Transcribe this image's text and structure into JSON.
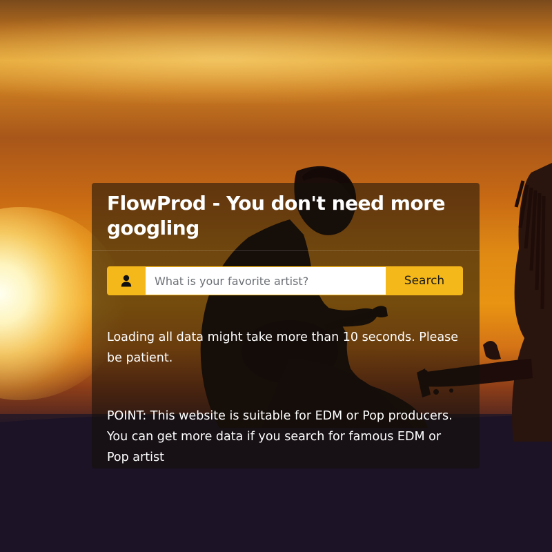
{
  "header": {
    "title": "FlowProd - You don't need more googling"
  },
  "search": {
    "icon": "user-icon",
    "placeholder": "What is your favorite artist?",
    "value": "",
    "button_label": "Search"
  },
  "info": {
    "loading_note": "Loading all data might take more than 10 seconds. Please be patient.",
    "point_note": "POINT: This website is suitable for EDM or Pop producers. You can get more data if you search for famous EDM or Pop artist"
  },
  "colors": {
    "accent": "#f5b81a",
    "panel_text": "#ffffff"
  }
}
